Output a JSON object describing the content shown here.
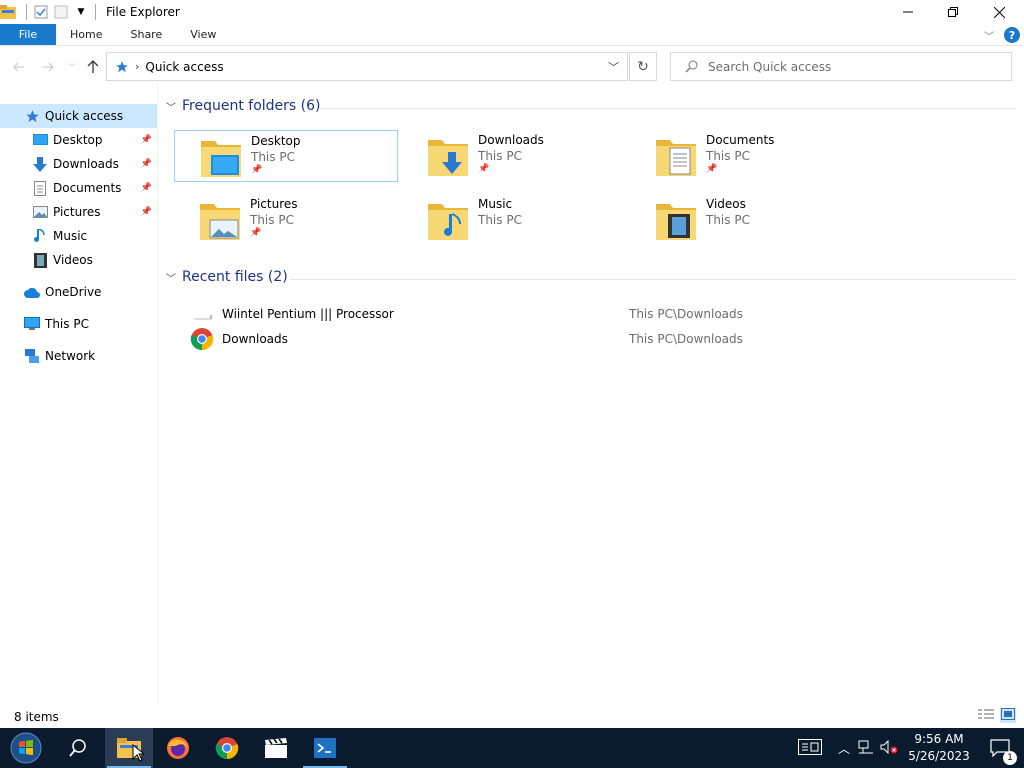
{
  "window": {
    "title": "File Explorer",
    "controls": {
      "minimize": "—",
      "maximize": "❐",
      "close": "✕"
    }
  },
  "ribbon": {
    "tabs": [
      "File",
      "Home",
      "Share",
      "View"
    ],
    "help": "?"
  },
  "address": {
    "location": "Quick access",
    "search_placeholder": "Search Quick access"
  },
  "navigation": {
    "items": [
      {
        "label": "Quick access",
        "icon": "star-icon",
        "selected": true
      },
      {
        "label": "Desktop",
        "icon": "desktop-icon",
        "pinned": true
      },
      {
        "label": "Downloads",
        "icon": "download-arrow-icon",
        "pinned": true
      },
      {
        "label": "Documents",
        "icon": "document-icon",
        "pinned": true
      },
      {
        "label": "Pictures",
        "icon": "picture-icon",
        "pinned": true
      },
      {
        "label": "Music",
        "icon": "music-note-icon"
      },
      {
        "label": "Videos",
        "icon": "film-icon"
      },
      {
        "label": "OneDrive",
        "icon": "cloud-icon"
      },
      {
        "label": "This PC",
        "icon": "monitor-icon"
      },
      {
        "label": "Network",
        "icon": "network-icon"
      }
    ]
  },
  "frequent_folders": {
    "heading": "Frequent folders (6)",
    "folders": [
      {
        "name": "Desktop",
        "location": "This PC",
        "pinned": true
      },
      {
        "name": "Downloads",
        "location": "This PC",
        "pinned": true
      },
      {
        "name": "Documents",
        "location": "This PC",
        "pinned": true
      },
      {
        "name": "Pictures",
        "location": "This PC",
        "pinned": true
      },
      {
        "name": "Music",
        "location": "This PC",
        "pinned": false
      },
      {
        "name": "Videos",
        "location": "This PC",
        "pinned": false
      }
    ]
  },
  "recent_files": {
    "heading": "Recent files (2)",
    "files": [
      {
        "name": "Wiintel Pentium ||| Processor",
        "path": "This PC\\Downloads",
        "icon": "blank-file-icon"
      },
      {
        "name": "Downloads",
        "path": "This PC\\Downloads",
        "icon": "chrome-icon"
      }
    ]
  },
  "status": {
    "item_count": "8 items"
  },
  "taskbar": {
    "time": "9:56 AM",
    "date": "5/26/2023",
    "notification_count": "1"
  },
  "colors": {
    "accent": "#1979ca",
    "group_heading": "#1e3287",
    "selection": "#cce8ff",
    "taskbar": "#0a1b2e"
  }
}
